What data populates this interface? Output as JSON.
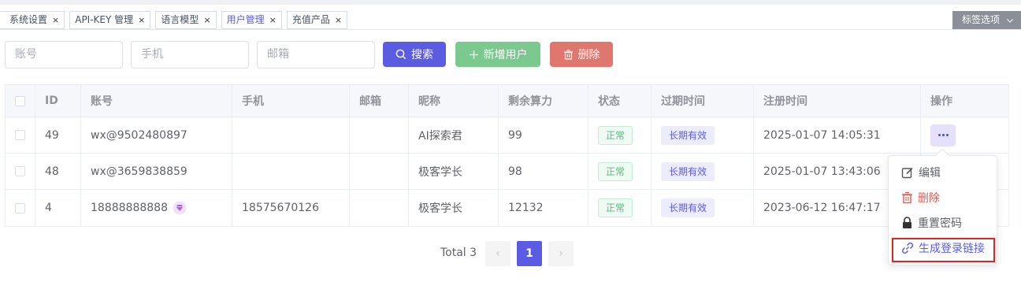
{
  "tabs": [
    {
      "label": "系统设置"
    },
    {
      "label": "API-KEY 管理"
    },
    {
      "label": "语言模型"
    },
    {
      "label": "用户管理"
    },
    {
      "label": "充值产品"
    }
  ],
  "tab_close_glyph": "×",
  "tab_options": {
    "label": "标签选项"
  },
  "search": {
    "account_placeholder": "账号",
    "phone_placeholder": "手机",
    "email_placeholder": "邮箱",
    "search_label": "搜索",
    "add_label": "新增用户",
    "delete_label": "删除"
  },
  "table": {
    "headers": [
      "ID",
      "账号",
      "手机",
      "邮箱",
      "昵称",
      "剩余算力",
      "状态",
      "过期时间",
      "注册时间",
      "操作"
    ],
    "rows": [
      {
        "id": "49",
        "account": "wx@9502480897",
        "phone": "",
        "email": "",
        "nickname": "AI探索君",
        "power": "99",
        "status": "正常",
        "expire": "长期有效",
        "registered": "2025-01-07 14:05:31"
      },
      {
        "id": "48",
        "account": "wx@3659838859",
        "phone": "",
        "email": "",
        "nickname": "极客学长",
        "power": "98",
        "status": "正常",
        "expire": "长期有效",
        "registered": "2025-01-07 13:43:06"
      },
      {
        "id": "4",
        "account": "18888888888",
        "phone": "18575670126",
        "email": "",
        "nickname": "极客学长",
        "power": "12132",
        "status": "正常",
        "expire": "长期有效",
        "registered": "2023-06-12 16:47:17"
      }
    ]
  },
  "dropdown": {
    "items": [
      {
        "label": "编辑",
        "icon": "edit-icon"
      },
      {
        "label": "删除",
        "icon": "trash-icon"
      },
      {
        "label": "重置密码",
        "icon": "lock-icon"
      },
      {
        "label": "生成登录链接",
        "icon": "link-icon"
      }
    ]
  },
  "pagination": {
    "total_label": "Total 3",
    "current_page": "1",
    "prev_glyph": "‹",
    "next_glyph": "›"
  },
  "colors": {
    "accent": "#5b5ce2",
    "success": "#7bc98f",
    "danger": "#e0776f",
    "highlight_border": "#e02424"
  }
}
